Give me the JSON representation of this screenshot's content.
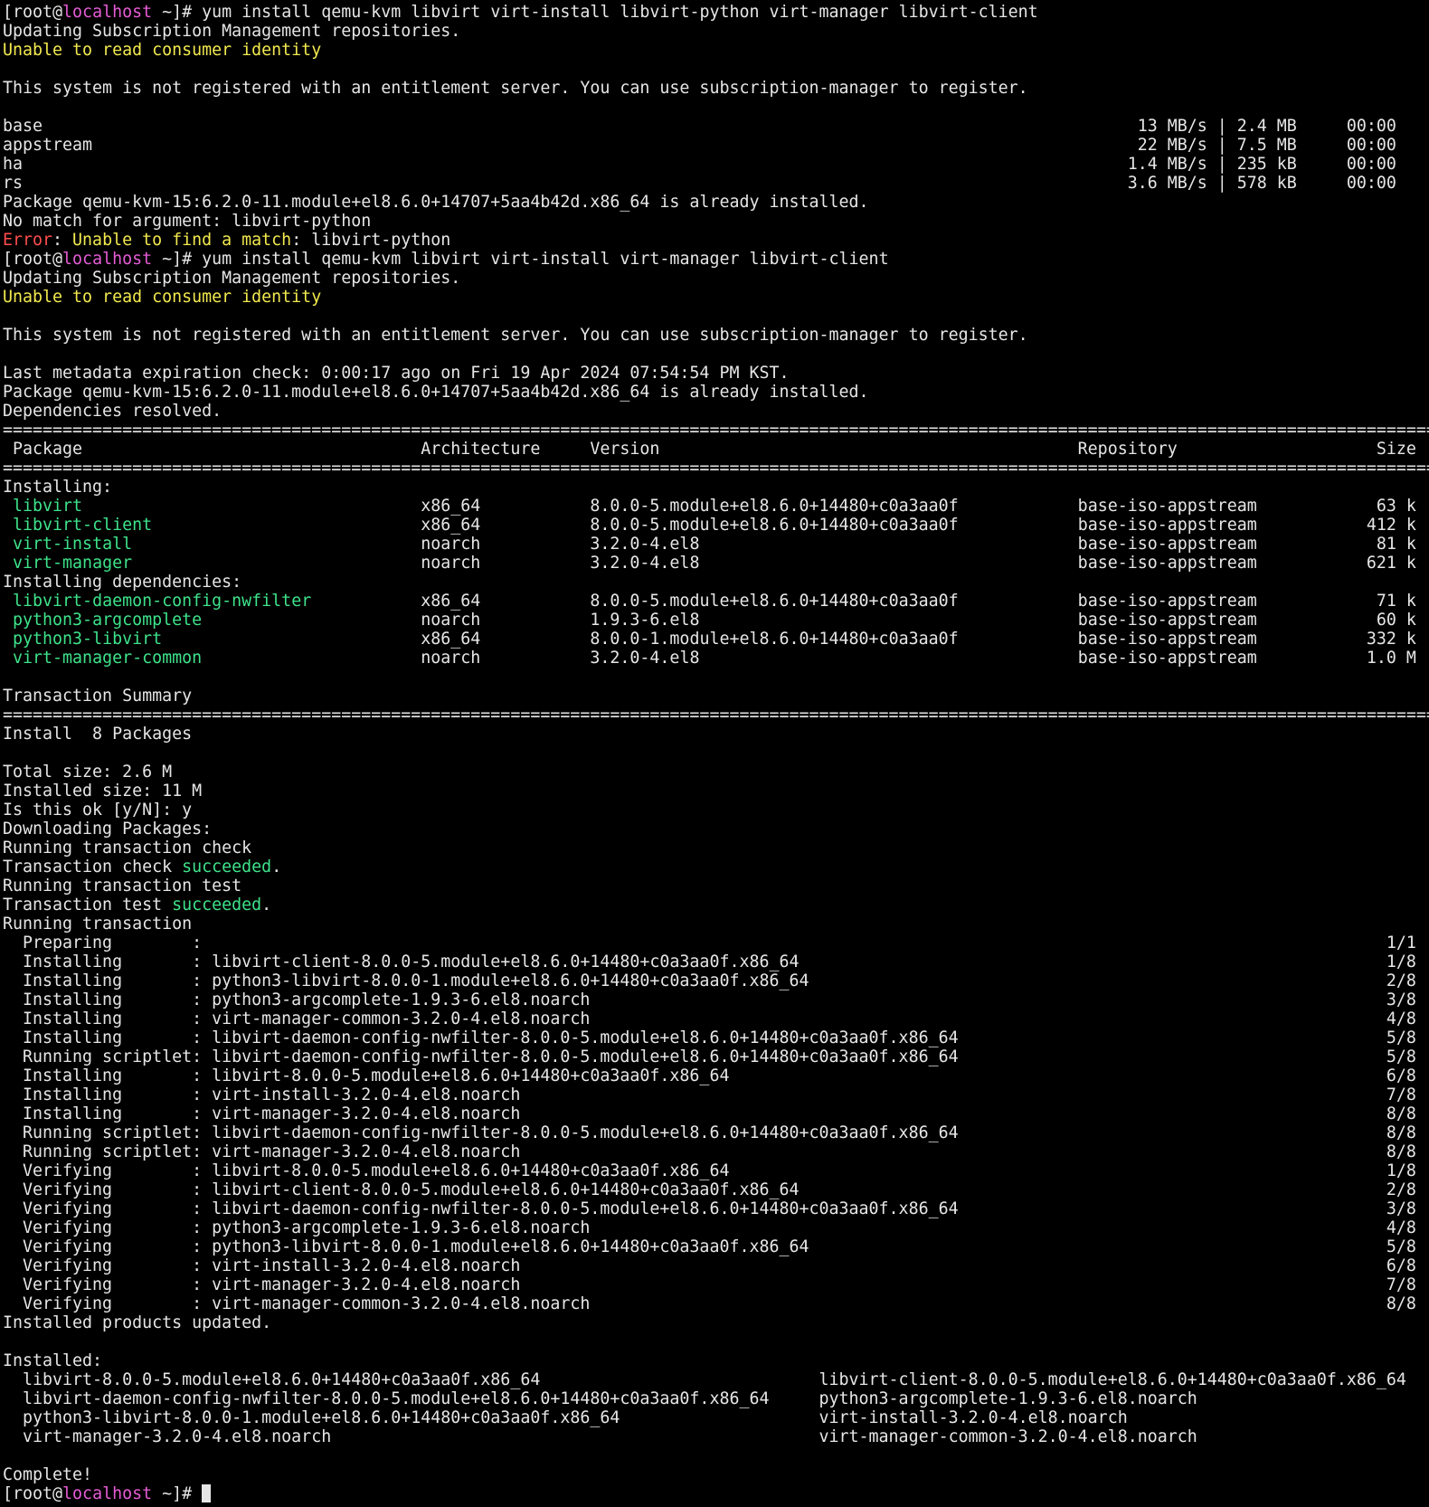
{
  "colors": {
    "background": "#000000",
    "foreground": "#e6e6e6",
    "hostname": "#e65cd6",
    "warning": "#f2e94e",
    "error": "#ff4d4d",
    "success": "#3ee38a"
  },
  "cursor_icon": "block-cursor",
  "lines": [
    [
      {
        "t": "[root@",
        "c": "white"
      },
      {
        "t": "localhost",
        "c": "magenta"
      },
      {
        "t": " ~]# yum install qemu-kvm libvirt virt-install libvirt-python virt-manager libvirt-client",
        "c": "white"
      }
    ],
    [
      {
        "t": "Updating Subscription Management repositories.",
        "c": "white"
      }
    ],
    [
      {
        "t": "Unable to read consumer identity",
        "c": "yellow"
      }
    ],
    [],
    [
      {
        "t": "This system is not registered with an entitlement server. You can use subscription-manager to register.",
        "c": "white"
      }
    ],
    [],
    [
      {
        "t": "base                                                                                                              13 MB/s | 2.4 MB     00:00",
        "c": "white"
      }
    ],
    [
      {
        "t": "appstream                                                                                                         22 MB/s | 7.5 MB     00:00",
        "c": "white"
      }
    ],
    [
      {
        "t": "ha                                                                                                               1.4 MB/s | 235 kB     00:00",
        "c": "white"
      }
    ],
    [
      {
        "t": "rs                                                                                                               3.6 MB/s | 578 kB     00:00",
        "c": "white"
      }
    ],
    [
      {
        "t": "Package qemu-kvm-15:6.2.0-11.module+el8.6.0+14707+5aa4b42d.x86_64 is already installed.",
        "c": "white"
      }
    ],
    [
      {
        "t": "No match for argument: libvirt-python",
        "c": "white"
      }
    ],
    [
      {
        "t": "Error",
        "c": "red"
      },
      {
        "t": ": ",
        "c": "white"
      },
      {
        "t": "Unable to find a match",
        "c": "yellow"
      },
      {
        "t": ": libvirt-python",
        "c": "white"
      }
    ],
    [
      {
        "t": "[root@",
        "c": "white"
      },
      {
        "t": "localhost",
        "c": "magenta"
      },
      {
        "t": " ~]# yum install qemu-kvm libvirt virt-install virt-manager libvirt-client",
        "c": "white"
      }
    ],
    [
      {
        "t": "Updating Subscription Management repositories.",
        "c": "white"
      }
    ],
    [
      {
        "t": "Unable to read consumer identity",
        "c": "yellow"
      }
    ],
    [],
    [
      {
        "t": "This system is not registered with an entitlement server. You can use subscription-manager to register.",
        "c": "white"
      }
    ],
    [],
    [
      {
        "t": "Last metadata expiration check: 0:00:17 ago on Fri 19 Apr 2024 07:54:54 PM KST.",
        "c": "white"
      }
    ],
    [
      {
        "t": "Package qemu-kvm-15:6.2.0-11.module+el8.6.0+14707+5aa4b42d.x86_64 is already installed.",
        "c": "white"
      }
    ],
    [
      {
        "t": "Dependencies resolved.",
        "c": "white"
      }
    ],
    [
      {
        "t": "=================================================================================================================================================",
        "c": "white"
      }
    ],
    [
      {
        "t": " Package                                  Architecture     Version                                          Repository                    Size",
        "c": "white"
      }
    ],
    [
      {
        "t": "=================================================================================================================================================",
        "c": "white"
      }
    ],
    [
      {
        "t": "Installing:",
        "c": "white"
      }
    ],
    [
      {
        "t": " ",
        "c": "white"
      },
      {
        "t": "libvirt",
        "c": "green"
      },
      {
        "t": "                                  x86_64           8.0.0-5.module+el8.6.0+14480+c0a3aa0f            base-iso-appstream            63 k",
        "c": "white"
      }
    ],
    [
      {
        "t": " ",
        "c": "white"
      },
      {
        "t": "libvirt-client",
        "c": "green"
      },
      {
        "t": "                           x86_64           8.0.0-5.module+el8.6.0+14480+c0a3aa0f            base-iso-appstream           412 k",
        "c": "white"
      }
    ],
    [
      {
        "t": " ",
        "c": "white"
      },
      {
        "t": "virt-install",
        "c": "green"
      },
      {
        "t": "                             noarch           3.2.0-4.el8                                      base-iso-appstream            81 k",
        "c": "white"
      }
    ],
    [
      {
        "t": " ",
        "c": "white"
      },
      {
        "t": "virt-manager",
        "c": "green"
      },
      {
        "t": "                             noarch           3.2.0-4.el8                                      base-iso-appstream           621 k",
        "c": "white"
      }
    ],
    [
      {
        "t": "Installing dependencies:",
        "c": "white"
      }
    ],
    [
      {
        "t": " ",
        "c": "white"
      },
      {
        "t": "libvirt-daemon-config-nwfilter",
        "c": "green"
      },
      {
        "t": "           x86_64           8.0.0-5.module+el8.6.0+14480+c0a3aa0f            base-iso-appstream            71 k",
        "c": "white"
      }
    ],
    [
      {
        "t": " ",
        "c": "white"
      },
      {
        "t": "python3-argcomplete",
        "c": "green"
      },
      {
        "t": "                      noarch           1.9.3-6.el8                                      base-iso-appstream            60 k",
        "c": "white"
      }
    ],
    [
      {
        "t": " ",
        "c": "white"
      },
      {
        "t": "python3-libvirt",
        "c": "green"
      },
      {
        "t": "                          x86_64           8.0.0-1.module+el8.6.0+14480+c0a3aa0f            base-iso-appstream           332 k",
        "c": "white"
      }
    ],
    [
      {
        "t": " ",
        "c": "white"
      },
      {
        "t": "virt-manager-common",
        "c": "green"
      },
      {
        "t": "                      noarch           3.2.0-4.el8                                      base-iso-appstream           1.0 M",
        "c": "white"
      }
    ],
    [],
    [
      {
        "t": "Transaction Summary",
        "c": "white"
      }
    ],
    [
      {
        "t": "=================================================================================================================================================",
        "c": "white"
      }
    ],
    [
      {
        "t": "Install  8 Packages",
        "c": "white"
      }
    ],
    [],
    [
      {
        "t": "Total size: 2.6 M",
        "c": "white"
      }
    ],
    [
      {
        "t": "Installed size: 11 M",
        "c": "white"
      }
    ],
    [
      {
        "t": "Is this ok [y/N]: y",
        "c": "white"
      }
    ],
    [
      {
        "t": "Downloading Packages:",
        "c": "white"
      }
    ],
    [
      {
        "t": "Running transaction check",
        "c": "white"
      }
    ],
    [
      {
        "t": "Transaction check ",
        "c": "white"
      },
      {
        "t": "succeeded",
        "c": "green"
      },
      {
        "t": ".",
        "c": "white"
      }
    ],
    [
      {
        "t": "Running transaction test",
        "c": "white"
      }
    ],
    [
      {
        "t": "Transaction test ",
        "c": "white"
      },
      {
        "t": "succeeded",
        "c": "green"
      },
      {
        "t": ".",
        "c": "white"
      }
    ],
    [
      {
        "t": "Running transaction",
        "c": "white"
      }
    ],
    [
      {
        "t": "  Preparing        :                                                                                                                       1/1",
        "c": "white"
      }
    ],
    [
      {
        "t": "  Installing       : libvirt-client-8.0.0-5.module+el8.6.0+14480+c0a3aa0f.x86_64                                                           1/8",
        "c": "white"
      }
    ],
    [
      {
        "t": "  Installing       : python3-libvirt-8.0.0-1.module+el8.6.0+14480+c0a3aa0f.x86_64                                                          2/8",
        "c": "white"
      }
    ],
    [
      {
        "t": "  Installing       : python3-argcomplete-1.9.3-6.el8.noarch                                                                                3/8",
        "c": "white"
      }
    ],
    [
      {
        "t": "  Installing       : virt-manager-common-3.2.0-4.el8.noarch                                                                                4/8",
        "c": "white"
      }
    ],
    [
      {
        "t": "  Installing       : libvirt-daemon-config-nwfilter-8.0.0-5.module+el8.6.0+14480+c0a3aa0f.x86_64                                           5/8",
        "c": "white"
      }
    ],
    [
      {
        "t": "  Running scriptlet: libvirt-daemon-config-nwfilter-8.0.0-5.module+el8.6.0+14480+c0a3aa0f.x86_64                                           5/8",
        "c": "white"
      }
    ],
    [
      {
        "t": "  Installing       : libvirt-8.0.0-5.module+el8.6.0+14480+c0a3aa0f.x86_64                                                                  6/8",
        "c": "white"
      }
    ],
    [
      {
        "t": "  Installing       : virt-install-3.2.0-4.el8.noarch                                                                                       7/8",
        "c": "white"
      }
    ],
    [
      {
        "t": "  Installing       : virt-manager-3.2.0-4.el8.noarch                                                                                       8/8",
        "c": "white"
      }
    ],
    [
      {
        "t": "  Running scriptlet: libvirt-daemon-config-nwfilter-8.0.0-5.module+el8.6.0+14480+c0a3aa0f.x86_64                                           8/8",
        "c": "white"
      }
    ],
    [
      {
        "t": "  Running scriptlet: virt-manager-3.2.0-4.el8.noarch                                                                                       8/8",
        "c": "white"
      }
    ],
    [
      {
        "t": "  Verifying        : libvirt-8.0.0-5.module+el8.6.0+14480+c0a3aa0f.x86_64                                                                  1/8",
        "c": "white"
      }
    ],
    [
      {
        "t": "  Verifying        : libvirt-client-8.0.0-5.module+el8.6.0+14480+c0a3aa0f.x86_64                                                           2/8",
        "c": "white"
      }
    ],
    [
      {
        "t": "  Verifying        : libvirt-daemon-config-nwfilter-8.0.0-5.module+el8.6.0+14480+c0a3aa0f.x86_64                                           3/8",
        "c": "white"
      }
    ],
    [
      {
        "t": "  Verifying        : python3-argcomplete-1.9.3-6.el8.noarch                                                                                4/8",
        "c": "white"
      }
    ],
    [
      {
        "t": "  Verifying        : python3-libvirt-8.0.0-1.module+el8.6.0+14480+c0a3aa0f.x86_64                                                          5/8",
        "c": "white"
      }
    ],
    [
      {
        "t": "  Verifying        : virt-install-3.2.0-4.el8.noarch                                                                                       6/8",
        "c": "white"
      }
    ],
    [
      {
        "t": "  Verifying        : virt-manager-3.2.0-4.el8.noarch                                                                                       7/8",
        "c": "white"
      }
    ],
    [
      {
        "t": "  Verifying        : virt-manager-common-3.2.0-4.el8.noarch                                                                                8/8",
        "c": "white"
      }
    ],
    [
      {
        "t": "Installed products updated.",
        "c": "white"
      }
    ],
    [],
    [
      {
        "t": "Installed:",
        "c": "white"
      }
    ],
    [
      {
        "t": "  libvirt-8.0.0-5.module+el8.6.0+14480+c0a3aa0f.x86_64                            libvirt-client-8.0.0-5.module+el8.6.0+14480+c0a3aa0f.x86_64",
        "c": "white"
      }
    ],
    [
      {
        "t": "  libvirt-daemon-config-nwfilter-8.0.0-5.module+el8.6.0+14480+c0a3aa0f.x86_64     python3-argcomplete-1.9.3-6.el8.noarch",
        "c": "white"
      }
    ],
    [
      {
        "t": "  python3-libvirt-8.0.0-1.module+el8.6.0+14480+c0a3aa0f.x86_64                    virt-install-3.2.0-4.el8.noarch",
        "c": "white"
      }
    ],
    [
      {
        "t": "  virt-manager-3.2.0-4.el8.noarch                                                 virt-manager-common-3.2.0-4.el8.noarch",
        "c": "white"
      }
    ],
    [],
    [
      {
        "t": "Complete!",
        "c": "white"
      }
    ],
    [
      {
        "t": "[root@",
        "c": "white"
      },
      {
        "t": "localhost",
        "c": "magenta"
      },
      {
        "t": " ~]# ",
        "c": "white"
      }
    ]
  ]
}
